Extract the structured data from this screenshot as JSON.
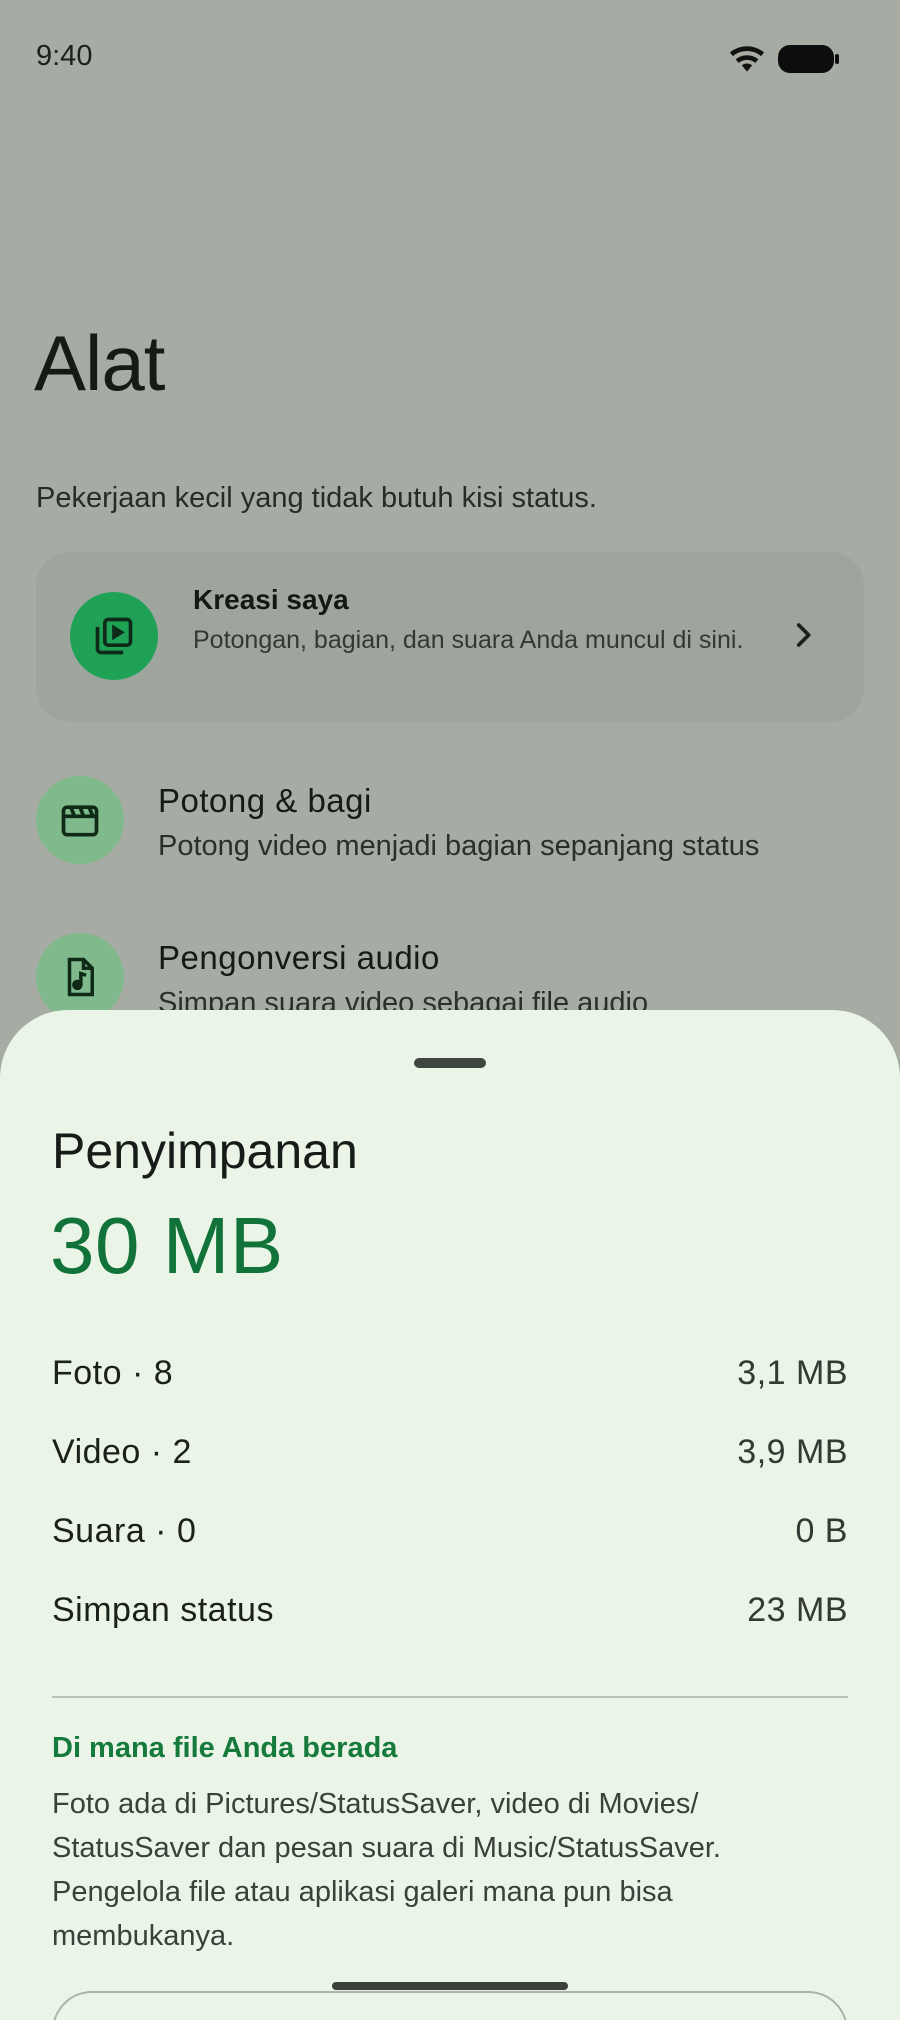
{
  "status_bar": {
    "time": "9:40",
    "wifi_icon": "wifi-icon",
    "battery_icon": "battery-icon"
  },
  "page": {
    "title": "Alat",
    "subtitle": "Pekerjaan kecil yang tidak butuh kisi status."
  },
  "creations_card": {
    "icon": "video-library-icon",
    "title": "Kreasi saya",
    "description": "Potongan, bagian, dan suara Anda muncul di sini.",
    "chevron": "chevron-right-icon"
  },
  "tools": [
    {
      "icon": "clapperboard-icon",
      "title": "Potong & bagi",
      "description": "Potong video menjadi bagian sepanjang status"
    },
    {
      "icon": "audio-file-icon",
      "title": "Pengonversi audio",
      "description": "Simpan suara video sebagai file audio"
    }
  ],
  "storage_sheet": {
    "title": "Penyimpanan",
    "total": "30 MB",
    "rows": [
      {
        "label": "Foto · 8",
        "value": "3,1 MB"
      },
      {
        "label": "Video · 2",
        "value": "3,9 MB"
      },
      {
        "label": "Suara · 0",
        "value": "0 B"
      },
      {
        "label": "Simpan status",
        "value": "23 MB"
      }
    ],
    "info_heading": "Di mana file Anda berada",
    "info_body": "Foto ada di Pictures/StatusSaver, video di Movies/ StatusSaver dan pesan suara di Music/StatusSaver. Pengelola file atau aplikasi galeri mana pun bisa membukanya."
  },
  "colors": {
    "accent_green": "#12733a",
    "card_icon_green": "#1fa256",
    "sheet_background": "#eaf5e7",
    "scrim_background": "#a6aca3"
  }
}
